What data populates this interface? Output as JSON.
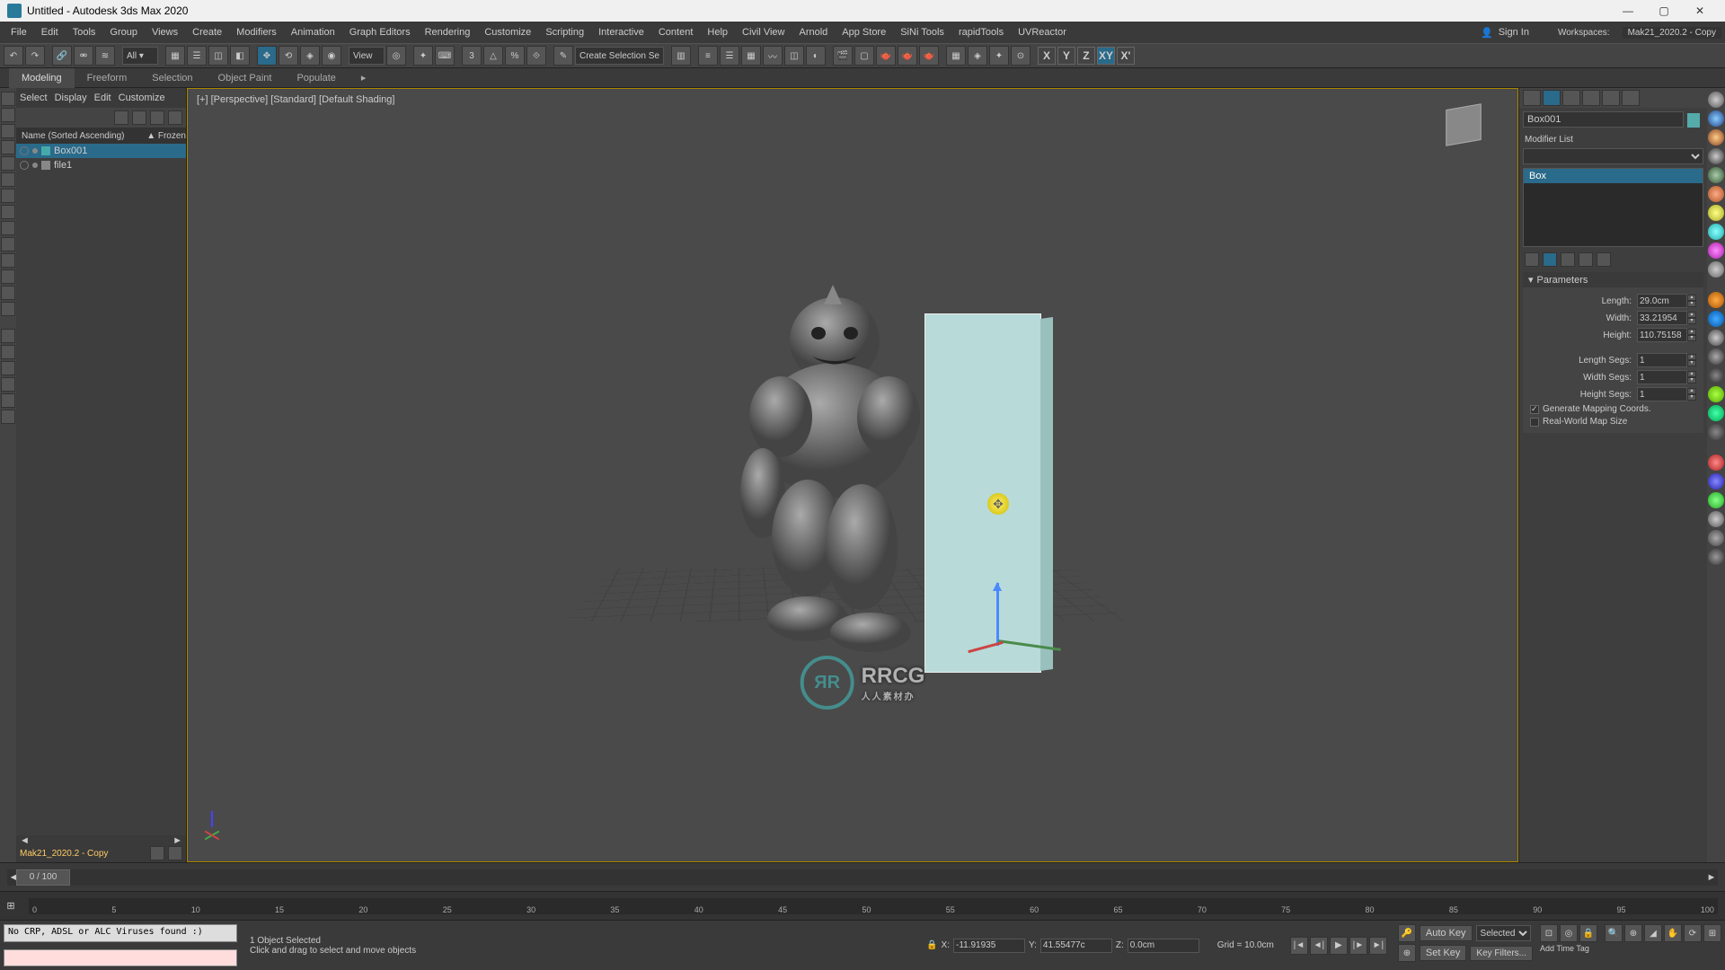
{
  "title": "Untitled - Autodesk 3ds Max 2020",
  "menu": [
    "File",
    "Edit",
    "Tools",
    "Group",
    "Views",
    "Create",
    "Modifiers",
    "Animation",
    "Graph Editors",
    "Rendering",
    "Customize",
    "Scripting",
    "Interactive",
    "Content",
    "Help",
    "Civil View",
    "Arnold",
    "App Store",
    "SiNi Tools",
    "rapidTools",
    "UVReactor"
  ],
  "signin": "Sign In",
  "workspace_label": "Workspaces:",
  "workspace_value": "Mak21_2020.2 - Copy",
  "toolbar": {
    "view": "View",
    "selset": "Create Selection Se",
    "axes": {
      "x": "X",
      "y": "Y",
      "z": "Z",
      "xy": "XY",
      "xyz": "X'"
    }
  },
  "ribbon": [
    "Modeling",
    "Freeform",
    "Selection",
    "Object Paint",
    "Populate"
  ],
  "explorer": {
    "tabs": [
      "Select",
      "Display",
      "Edit",
      "Customize"
    ],
    "header": {
      "name": "Name (Sorted Ascending)",
      "frozen": "▲ Frozen"
    },
    "items": [
      {
        "name": "Box001",
        "selected": true
      },
      {
        "name": "file1",
        "selected": false
      }
    ],
    "footer": "Mak21_2020.2 - Copy"
  },
  "viewport": {
    "label": "[+] [Perspective] [Standard] [Default Shading]"
  },
  "cmdpanel": {
    "object_name": "Box001",
    "mod_label": "Modifier List",
    "stack_item": "Box",
    "rollup_title": "Parameters",
    "params": {
      "length": {
        "label": "Length:",
        "value": "29.0cm"
      },
      "width": {
        "label": "Width:",
        "value": "33.21954"
      },
      "height": {
        "label": "Height:",
        "value": "110.75158"
      },
      "lsegs": {
        "label": "Length Segs:",
        "value": "1"
      },
      "wsegs": {
        "label": "Width Segs:",
        "value": "1"
      },
      "hsegs": {
        "label": "Height Segs:",
        "value": "1"
      }
    },
    "gen_mapping": "Generate Mapping Coords.",
    "real_world": "Real-World Map Size"
  },
  "timeslider": {
    "frame": "0 / 100"
  },
  "track_ticks": [
    "0",
    "5",
    "10",
    "15",
    "20",
    "25",
    "30",
    "35",
    "40",
    "45",
    "50",
    "55",
    "60",
    "65",
    "70",
    "75",
    "80",
    "85",
    "90",
    "95",
    "100"
  ],
  "status": {
    "maxscript": "No CRP, ADSL or ALC Viruses found :)",
    "selected": "1 Object Selected",
    "hint": "Click and drag to select and move objects",
    "coords": {
      "x_label": "X:",
      "x": "-11.91935",
      "y_label": "Y:",
      "y": "41.55477c",
      "z_label": "Z:",
      "z": "0.0cm"
    },
    "grid": "Grid = 10.0cm",
    "autokey": "Auto Key",
    "setkey": "Set Key",
    "selected_mode": "Selected",
    "timetag": "Add Time Tag",
    "keyfilters": "Key Filters..."
  },
  "watermark": {
    "logo": "ЯR",
    "main": "RRCG",
    "sub": "人人素材办"
  }
}
